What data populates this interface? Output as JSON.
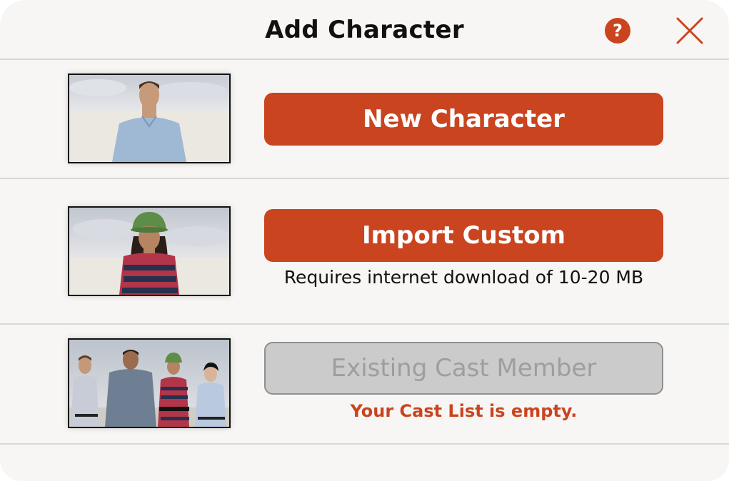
{
  "dialog": {
    "title": "Add Character",
    "help_symbol": "?",
    "help_icon": "question-circle-icon",
    "close_icon": "close-x-icon"
  },
  "options": [
    {
      "button_label": "New Character",
      "note": "",
      "enabled": true
    },
    {
      "button_label": "Import Custom",
      "note": "Requires internet download of 10-20 MB",
      "enabled": true
    },
    {
      "button_label": "Existing Cast Member",
      "note": "Your Cast List is empty.",
      "enabled": false
    }
  ],
  "colors": {
    "accent": "#c9441f",
    "background": "#f7f6f4",
    "disabled_fill": "#cbcbcb",
    "disabled_text": "#9e9e9e"
  }
}
